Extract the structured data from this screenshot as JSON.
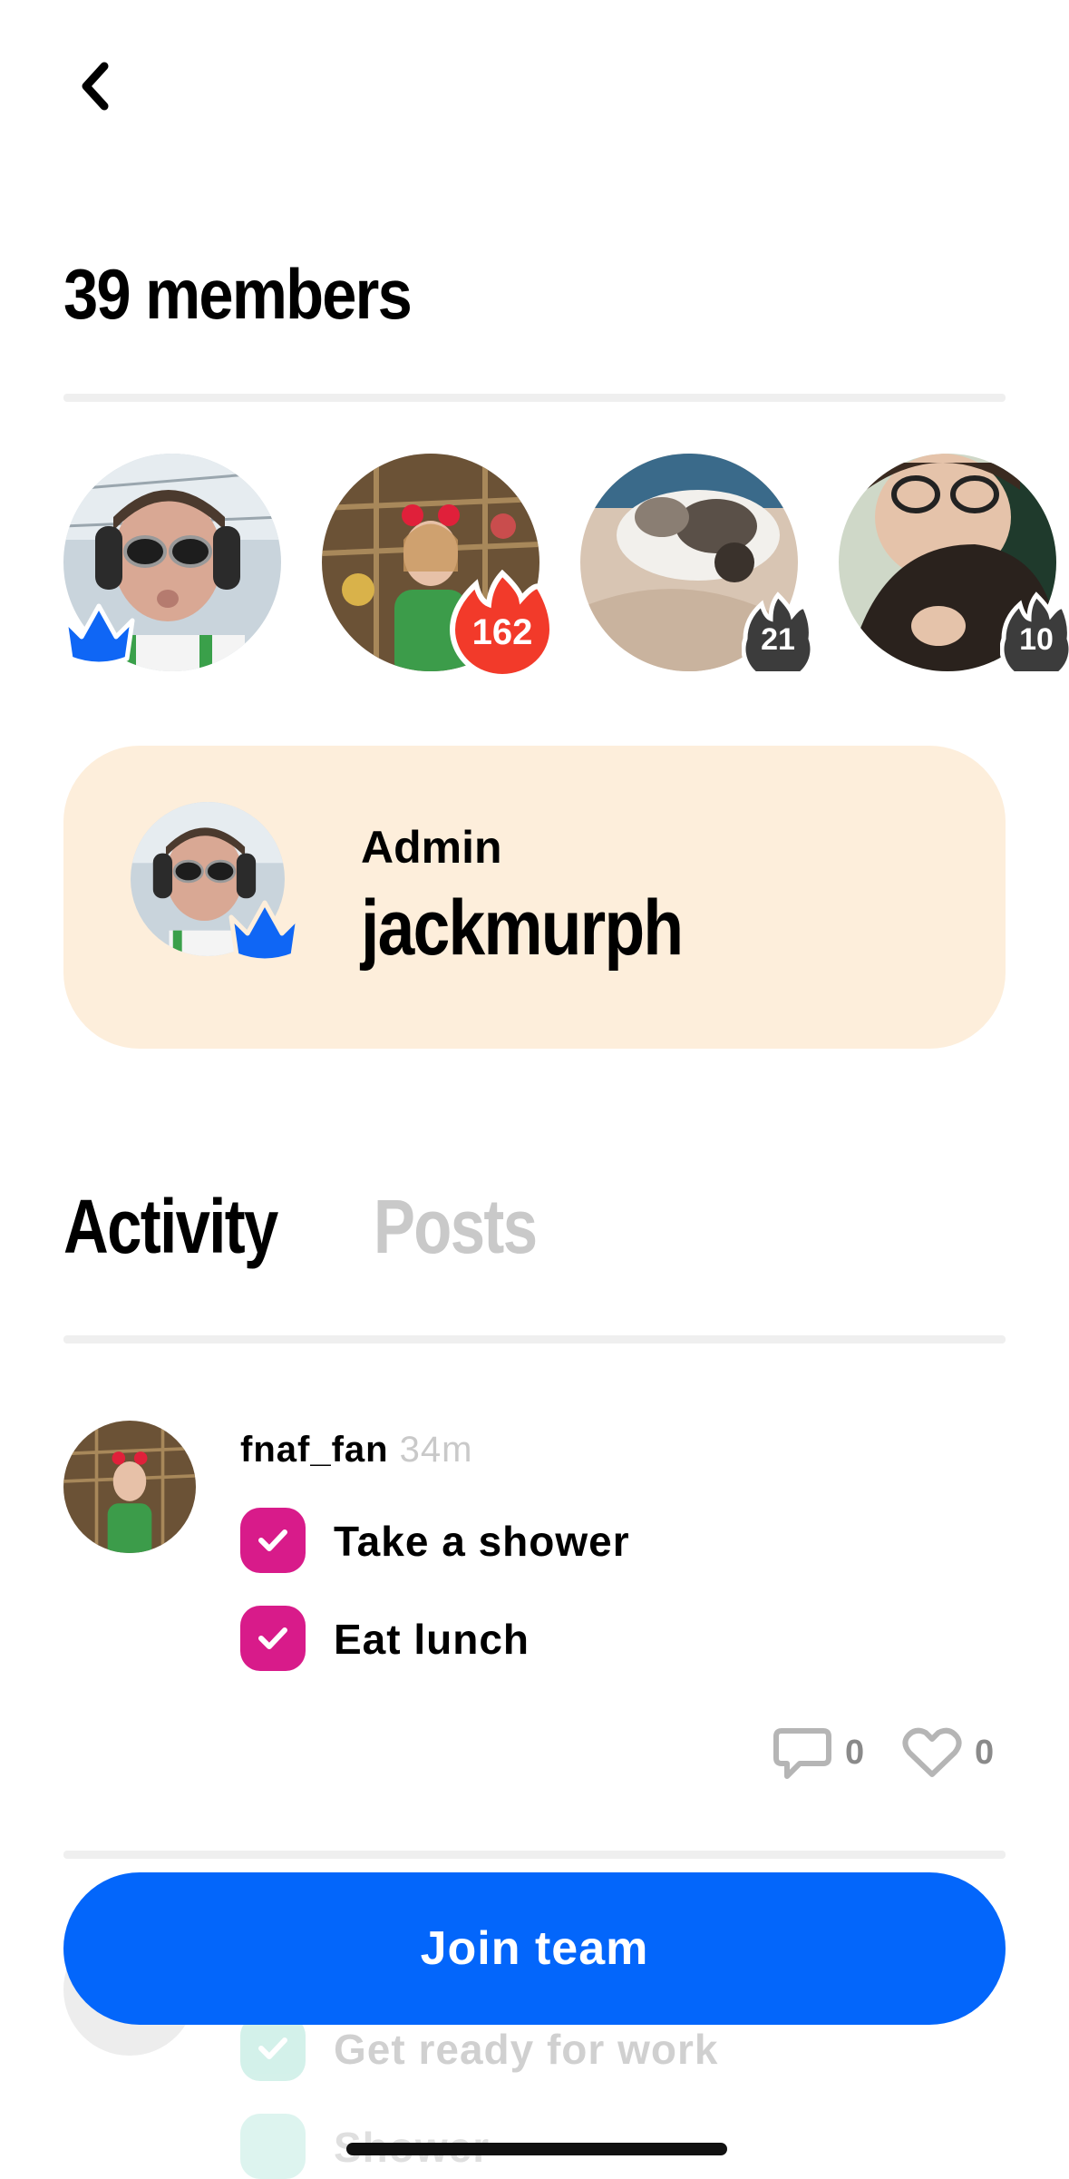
{
  "header": {
    "back_icon": "chevron-left-icon",
    "title": "39 members"
  },
  "members": [
    {
      "role": "admin",
      "badge_icon": "crown-icon",
      "badge_color": "#0f66f5"
    },
    {
      "streak": "162",
      "badge_color": "#f23a2a"
    },
    {
      "streak": "21",
      "badge_color": "#3c3c3c"
    },
    {
      "streak": "10",
      "badge_color": "#3c3c3c"
    }
  ],
  "admin_card": {
    "label": "Admin",
    "username": "jackmurph",
    "badge_icon": "crown-icon",
    "background": "#fdeedb"
  },
  "tabs": [
    {
      "label": "Activity",
      "active": true
    },
    {
      "label": "Posts",
      "active": false
    }
  ],
  "activity": [
    {
      "user": "fnaf_fan",
      "time": "34m",
      "tasks": [
        "Take a shower",
        "Eat lunch"
      ],
      "comments": "0",
      "likes": "0"
    },
    {
      "tasks": [
        "Get ready for work",
        "Shower"
      ]
    }
  ],
  "join_button": {
    "label": "Join team",
    "color": "#0366fb"
  },
  "colors": {
    "check": "#d81b8a",
    "check_faded": "#53c9ad",
    "inactive_tab": "#c9c9c9"
  }
}
